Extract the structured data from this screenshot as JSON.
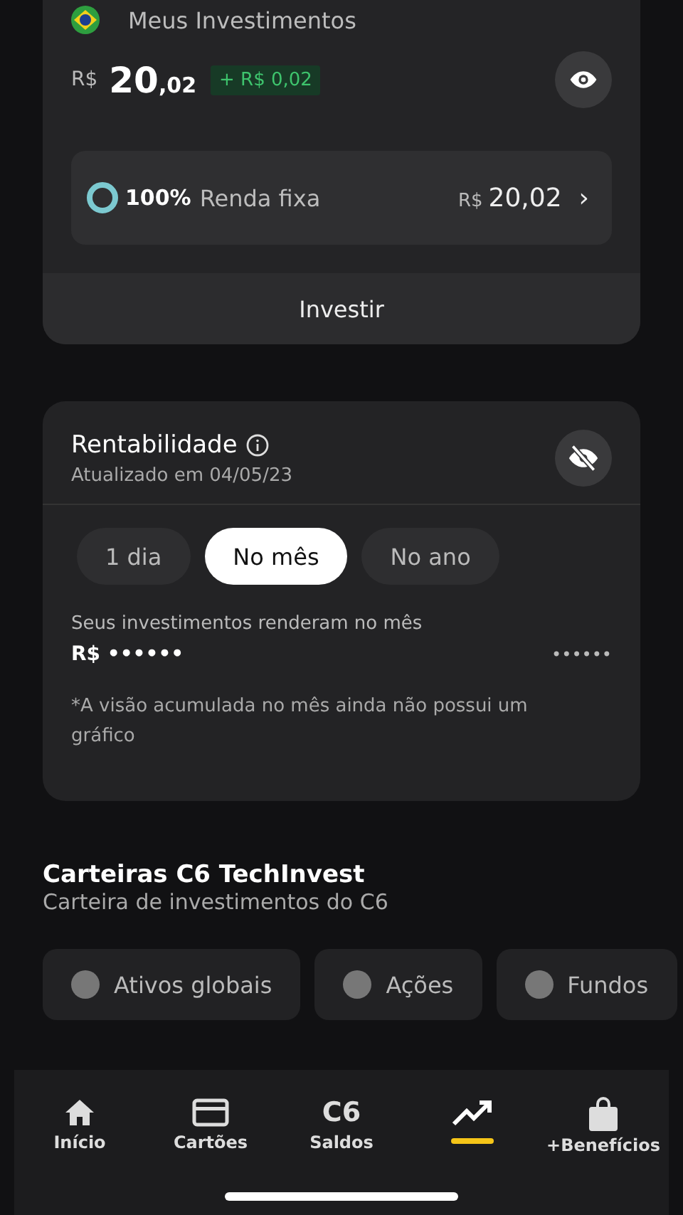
{
  "investments": {
    "title": "Meus Investimentos",
    "currency": "R$",
    "amount_int": "20",
    "amount_dec": ",02",
    "change": "+ R$ 0,02",
    "allocation": {
      "percent": "100%",
      "label": "Renda fixa",
      "currency": "R$",
      "value": "20,02",
      "chevron": "›"
    },
    "action": "Investir"
  },
  "profitability": {
    "title": "Rentabilidade",
    "updated": "Atualizado em 04/05/23",
    "periods": [
      {
        "label": "1 dia",
        "selected": false
      },
      {
        "label": "No mês",
        "selected": true
      },
      {
        "label": "No ano",
        "selected": false
      }
    ],
    "caption": "Seus investimentos renderam no mês",
    "currency": "R$",
    "hidden_value": "••••••",
    "hidden_percent": "••••••",
    "note": "*A visão acumulada no mês ainda não possui um gráfico"
  },
  "portfolios": {
    "title": "Carteiras C6 TechInvest",
    "subtitle": "Carteira de investimentos do C6",
    "chips": [
      {
        "label": "Ativos globais"
      },
      {
        "label": "Ações"
      },
      {
        "label": "Fundos"
      }
    ]
  },
  "nav": [
    {
      "kind": "home",
      "label": "Início",
      "selected": false
    },
    {
      "kind": "card",
      "label": "Cartões",
      "selected": false
    },
    {
      "kind": "logo",
      "logo": "C6",
      "label": "Saldos",
      "selected": false
    },
    {
      "kind": "chart",
      "selected": true
    },
    {
      "kind": "bag",
      "label": "+Benefícios",
      "selected": false
    }
  ]
}
